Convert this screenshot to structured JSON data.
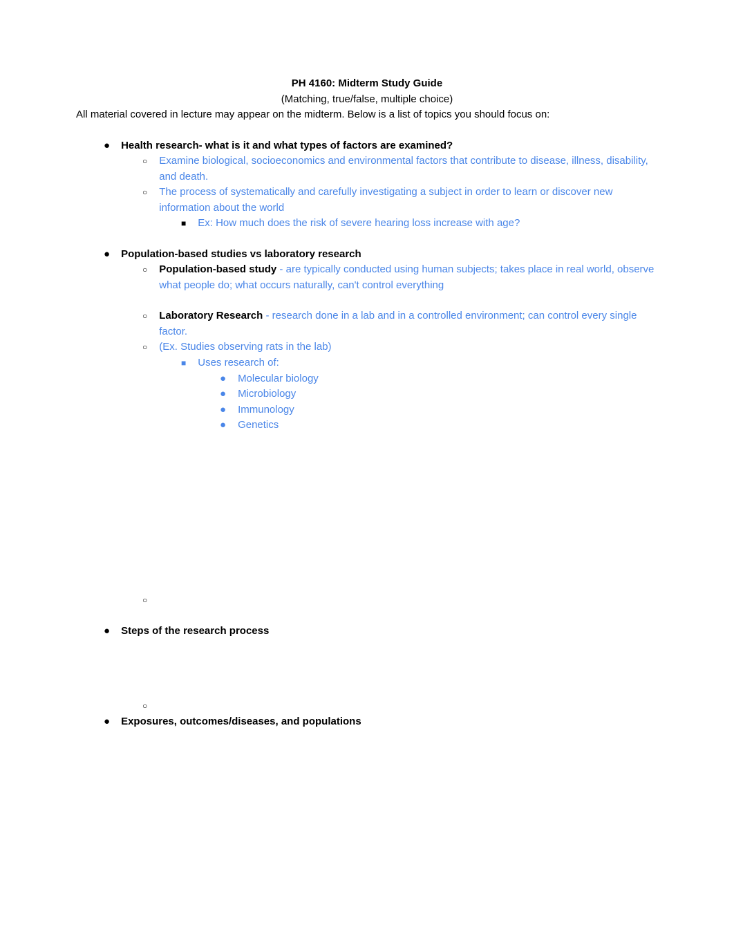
{
  "title": "PH 4160: Midterm Study Guide",
  "subtitle": "(Matching, true/false, multiple choice)",
  "intro": "All material covered in lecture may appear on the midterm. Below is a list of topics you should focus on:",
  "topics": {
    "health_research": {
      "heading": "Health research- what is it and what types of factors are examined?",
      "point1": "Examine biological, socioeconomics and environmental factors that contribute to disease, illness, disability, and death.",
      "point2": "The process of systematically and carefully investigating a subject in order to learn or discover new information about the world",
      "example": "Ex: How much does the risk of severe hearing loss increase with age?"
    },
    "population_vs_lab": {
      "heading": "Population-based studies vs laboratory research",
      "pop_label": "Population-based study",
      "pop_sep": " -  ",
      "pop_desc": "are typically conducted using human subjects; takes place in real world, observe what people do; what occurs naturally, can't control everything",
      "lab_label": "Laboratory Research",
      "lab_sep": " - ",
      "lab_desc": "research done in a lab and in a controlled environment; can control every single factor.",
      "lab_example": "(Ex. Studies observing rats in the lab)",
      "uses_research": "Uses research of:",
      "fields": {
        "f1": "Molecular biology",
        "f2": "Microbiology",
        "f3": "Immunology",
        "f4": "Genetics"
      }
    },
    "steps": {
      "heading": "Steps of the research process"
    },
    "exposures": {
      "heading": "Exposures, outcomes/diseases, and populations"
    }
  }
}
